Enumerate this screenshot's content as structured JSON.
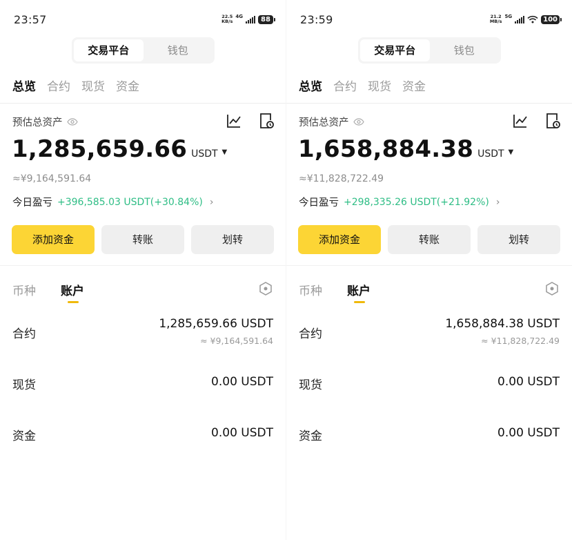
{
  "panels": [
    {
      "status": {
        "time": "23:57",
        "net_top": "22.5",
        "net_bottom": "KB/s",
        "gen": "4G",
        "battery": "88"
      },
      "segment": {
        "tab1": "交易平台",
        "tab2": "钱包"
      },
      "tabs": [
        "总览",
        "合约",
        "现货",
        "资金"
      ],
      "est_label": "预估总资产",
      "total": "1,285,659.66",
      "currency": "USDT",
      "cny": "≈¥9,164,591.64",
      "pnl_label": "今日盈亏",
      "pnl_value": "+396,585.03 USDT(+30.84%)",
      "buttons": [
        "添加资金",
        "转账",
        "划转"
      ],
      "subtabs": [
        "币种",
        "账户"
      ],
      "accounts": [
        {
          "name": "合约",
          "value": "1,285,659.66 USDT",
          "sub": "≈ ¥9,164,591.64"
        },
        {
          "name": "现货",
          "value": "0.00 USDT",
          "sub": ""
        },
        {
          "name": "资金",
          "value": "0.00 USDT",
          "sub": ""
        }
      ]
    },
    {
      "status": {
        "time": "23:59",
        "net_top": "21.2",
        "net_bottom": "MB/s",
        "gen": "5G",
        "battery": "100"
      },
      "segment": {
        "tab1": "交易平台",
        "tab2": "钱包"
      },
      "tabs": [
        "总览",
        "合约",
        "现货",
        "资金"
      ],
      "est_label": "预估总资产",
      "total": "1,658,884.38",
      "currency": "USDT",
      "cny": "≈¥11,828,722.49",
      "pnl_label": "今日盈亏",
      "pnl_value": "+298,335.26 USDT(+21.92%)",
      "buttons": [
        "添加资金",
        "转账",
        "划转"
      ],
      "subtabs": [
        "币种",
        "账户"
      ],
      "accounts": [
        {
          "name": "合约",
          "value": "1,658,884.38 USDT",
          "sub": "≈ ¥11,828,722.49"
        },
        {
          "name": "现货",
          "value": "0.00 USDT",
          "sub": ""
        },
        {
          "name": "资金",
          "value": "0.00 USDT",
          "sub": ""
        }
      ]
    }
  ],
  "colors": {
    "accent": "#fcd535",
    "profit": "#2ebd85",
    "underline": "#f0b90b"
  },
  "icons": [
    "eye-icon",
    "chart-icon",
    "history-icon",
    "chevron-right-icon",
    "caret-down-icon",
    "hexagon-settings-icon",
    "wifi-icon",
    "signal-icon",
    "battery-icon"
  ]
}
